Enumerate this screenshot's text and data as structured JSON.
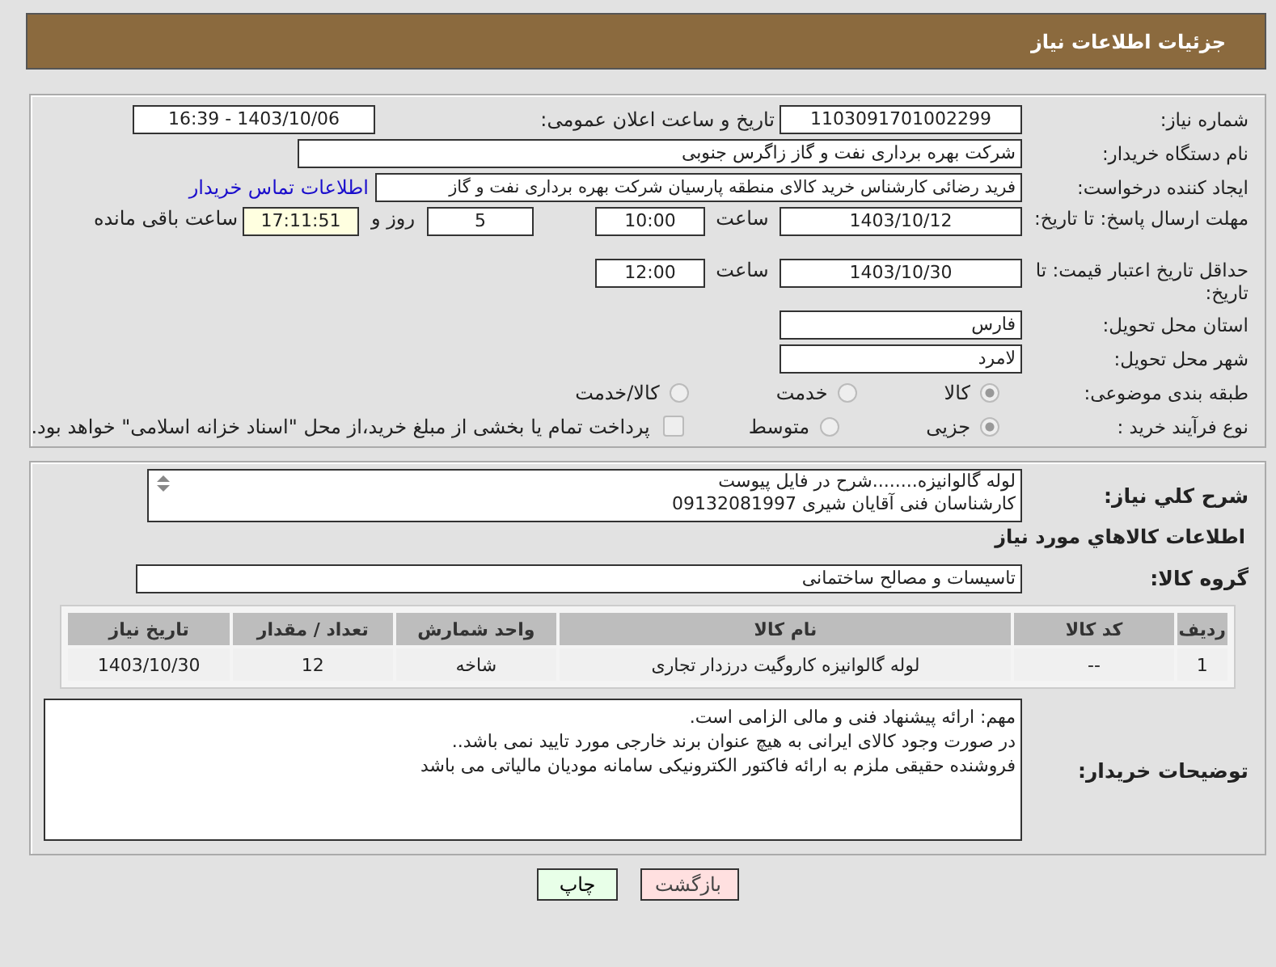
{
  "header": {
    "title": "جزئیات اطلاعات نیاز"
  },
  "need_number": {
    "label": "شماره نیاز:",
    "value": "1103091701002299"
  },
  "announce": {
    "label": "تاریخ و ساعت اعلان عمومی:",
    "value": "1403/10/06 - 16:39"
  },
  "buyer": {
    "label": "نام دستگاه خریدار:",
    "value": "شرکت بهره برداری نفت و گاز زاگرس جنوبی"
  },
  "creator": {
    "label": "ایجاد کننده درخواست:",
    "value": "فرید رضائی کارشناس خرید کالای منطقه پارسیان شرکت بهره برداری نفت و گاز",
    "link": "اطلاعات تماس خریدار"
  },
  "deadline": {
    "label": "مهلت ارسال پاسخ: تا تاریخ:",
    "date": "1403/10/12",
    "time_label": "ساعت",
    "time": "10:00",
    "days": "5",
    "days_label": "روز و",
    "remaining": "17:11:51",
    "remaining_label": "ساعت باقی مانده"
  },
  "validity": {
    "label": "حداقل تاریخ اعتبار قیمت: تا تاریخ:",
    "date": "1403/10/30",
    "time_label": "ساعت",
    "time": "12:00"
  },
  "province": {
    "label": "استان محل تحویل:",
    "value": "فارس"
  },
  "city": {
    "label": "شهر محل تحویل:",
    "value": "لامرد"
  },
  "category": {
    "label": "طبقه بندی موضوعی:",
    "options": [
      {
        "label": "کالا",
        "selected": true
      },
      {
        "label": "خدمت",
        "selected": false
      },
      {
        "label": "کالا/خدمت",
        "selected": false
      }
    ]
  },
  "purchase_type": {
    "label": "نوع فرآیند خرید :",
    "options": [
      {
        "label": "جزیی",
        "selected": true
      },
      {
        "label": "متوسط",
        "selected": false
      }
    ],
    "payment": {
      "label": "پرداخت تمام یا بخشی از مبلغ خرید،از محل \"اسناد خزانه اسلامی\" خواهد بود.",
      "checked": false
    }
  },
  "description": {
    "label": "شرح کلي نياز:",
    "lines": [
      "لوله گالوانیزه........شرح در فایل پیوست",
      "کارشناسان فنی آقایان شیری 09132081997"
    ]
  },
  "goods_heading": "اطلاعات کالاهاي مورد نياز",
  "goods_group": {
    "label": "گروه کالا:",
    "value": "تاسیسات و مصالح ساختمانی"
  },
  "table": {
    "columns": [
      "ردیف",
      "کد کالا",
      "نام کالا",
      "واحد شمارش",
      "تعداد / مقدار",
      "تاریخ نیاز"
    ],
    "rows": [
      [
        "1",
        "--",
        "لوله گالوانیزه کاروگیت درزدار تجاری",
        "شاخه",
        "12",
        "1403/10/30"
      ]
    ]
  },
  "notes": {
    "label": "توضیحات خریدار:",
    "lines": [
      "مهم: ارائه پیشنهاد فنی و مالی الزامی است.",
      "در صورت وجود کالای ایرانی به هیچ عنوان برند خارجی مورد تایید نمی باشد..",
      "فروشنده حقیقی ملزم به ارائه فاکتور الکترونیکی سامانه مودیان مالیاتی می باشد"
    ]
  },
  "buttons": [
    {
      "kind": "back",
      "label": "بازگشت"
    },
    {
      "kind": "print",
      "label": "چاپ"
    }
  ]
}
